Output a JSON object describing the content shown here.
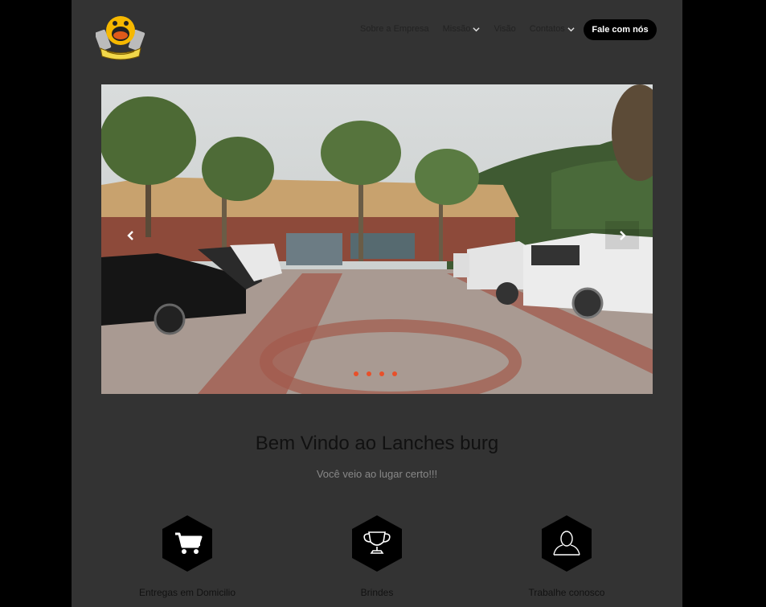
{
  "nav": {
    "items": [
      {
        "label": "Sobre a Empresa",
        "dropdown": false
      },
      {
        "label": "Missão",
        "dropdown": true
      },
      {
        "label": "Visão",
        "dropdown": false
      },
      {
        "label": "Contatos",
        "dropdown": true
      }
    ],
    "cta_label": "Fale com nós"
  },
  "carousel": {
    "slides_count": 4,
    "active_slide": 1,
    "prev_icon": "chevron-left-icon",
    "next_icon": "chevron-right-icon",
    "dot_color": "#e8502a"
  },
  "hero": {
    "title": "Bem Vindo ao Lanches burg",
    "subtitle": "Você veio ao lugar certo!!!"
  },
  "features": [
    {
      "label": "Entregas em Domicilio",
      "icon": "shopping-cart-icon"
    },
    {
      "label": "Brindes",
      "icon": "trophy-icon"
    },
    {
      "label": "Trabalhe conosco",
      "icon": "user-icon"
    }
  ],
  "colors": {
    "background": "#000000",
    "page": "#333333",
    "accent": "#e8502a"
  }
}
